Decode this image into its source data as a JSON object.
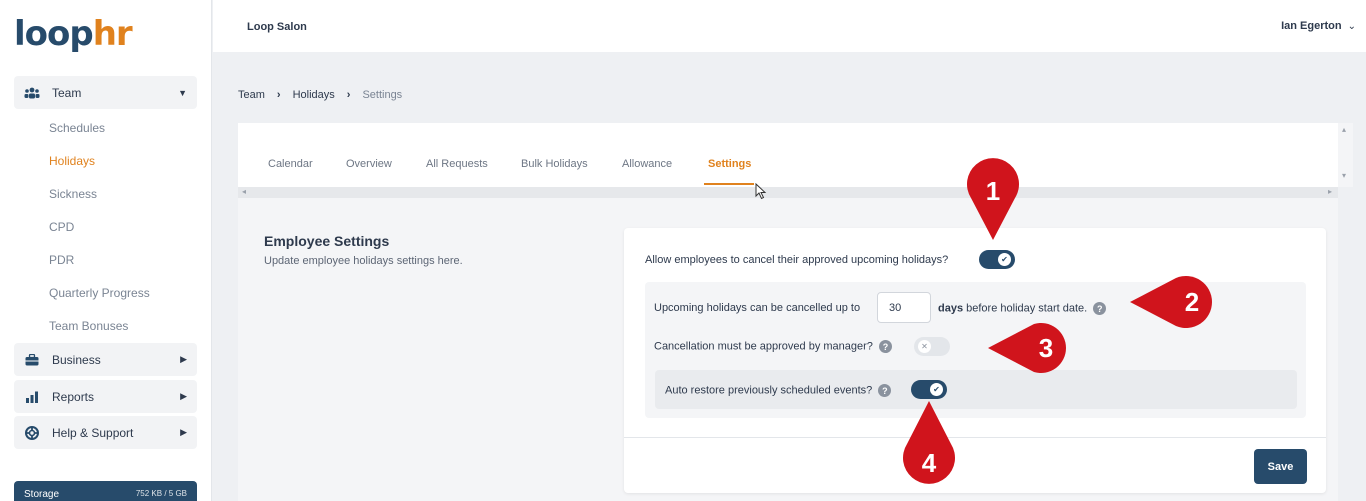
{
  "app": {
    "logo_part1": "loop",
    "logo_part2": "hr",
    "organization": "Loop Salon",
    "user_name": "Ian Egerton"
  },
  "sidebar": {
    "team_label": "Team",
    "team_items": [
      {
        "label": "Schedules"
      },
      {
        "label": "Holidays",
        "active": true
      },
      {
        "label": "Sickness"
      },
      {
        "label": "CPD"
      },
      {
        "label": "PDR"
      },
      {
        "label": "Quarterly Progress"
      },
      {
        "label": "Team Bonuses"
      }
    ],
    "business_label": "Business",
    "reports_label": "Reports",
    "help_label": "Help & Support",
    "storage_label": "Storage",
    "storage_value": "752 KB / 5 GB"
  },
  "breadcrumb": {
    "items": [
      "Team",
      "Holidays",
      "Settings"
    ]
  },
  "tabs": [
    {
      "label": "Calendar"
    },
    {
      "label": "Overview"
    },
    {
      "label": "All Requests"
    },
    {
      "label": "Bulk Holidays"
    },
    {
      "label": "Allowance"
    },
    {
      "label": "Settings",
      "active": true
    }
  ],
  "section": {
    "title": "Employee Settings",
    "description": "Update employee holidays settings here."
  },
  "settings": {
    "allow_cancel_label": "Allow employees to cancel their approved upcoming holidays?",
    "allow_cancel_on": true,
    "cancel_prefix": "Upcoming holidays can be cancelled up to",
    "cancel_days": "30",
    "cancel_days_word": "days",
    "cancel_suffix": "before holiday start date.",
    "manager_approval_label": "Cancellation must be approved by manager?",
    "manager_approval_on": false,
    "auto_restore_label": "Auto restore previously scheduled events?",
    "auto_restore_on": true,
    "save_label": "Save"
  },
  "callouts": [
    "1",
    "2",
    "3",
    "4"
  ],
  "colors": {
    "primary": "#274b6b",
    "accent": "#e0821e",
    "callout": "#d0141c"
  }
}
